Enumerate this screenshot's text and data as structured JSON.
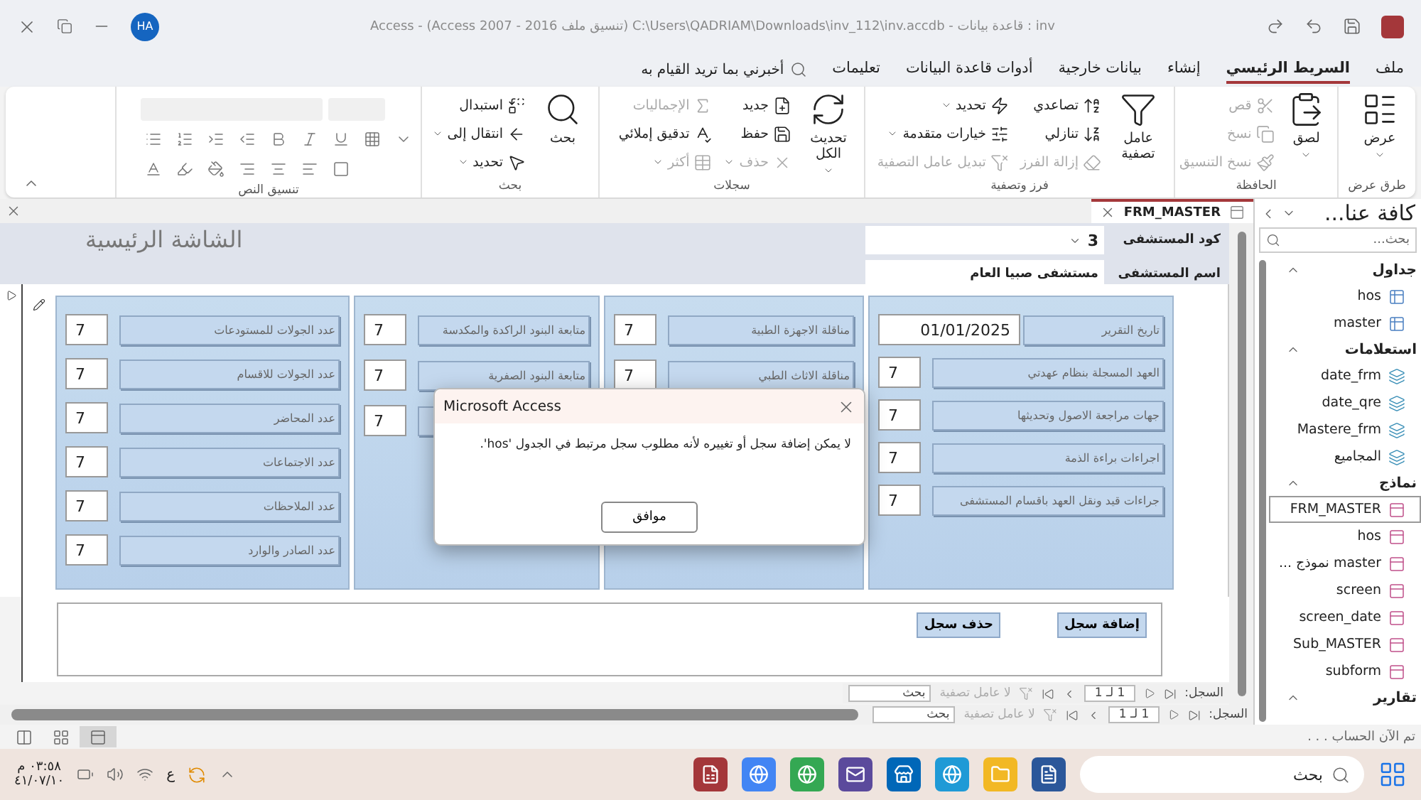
{
  "title_bar": {
    "title": "Access - (Access 2007 - 2016 تنسيق ملف) C:\\Users\\QADRIAM\\Downloads\\inv_112\\inv.accdb - قاعدة بيانات : inv",
    "avatar": "HA"
  },
  "menu": {
    "tabs": [
      {
        "label": "ملف",
        "selected": false
      },
      {
        "label": "السريط الرئيسي",
        "selected": true
      },
      {
        "label": "إنشاء",
        "selected": false
      },
      {
        "label": "بيانات خارجية",
        "selected": false
      },
      {
        "label": "أدوات قاعدة البيانات",
        "selected": false
      },
      {
        "label": "تعليمات",
        "selected": false
      }
    ],
    "tell_me": "أخبرني بما تريد القيام به"
  },
  "ribbon": {
    "groups": [
      {
        "label": "طرق عرض",
        "items": [
          {
            "label": "عرض",
            "kind": "large",
            "dropdown": true,
            "disabled": false
          }
        ]
      },
      {
        "label": "الحافظة",
        "items": [
          {
            "label": "لصق",
            "kind": "large",
            "dropdown": true,
            "disabled": false
          },
          {
            "label": "قص",
            "kind": "small",
            "disabled": true
          },
          {
            "label": "نسخ",
            "kind": "small",
            "disabled": true
          },
          {
            "label": "نسخ التنسيق",
            "kind": "small",
            "disabled": true
          }
        ]
      },
      {
        "label": "فرز وتصفية",
        "items": [
          {
            "label": "عامل تصفية",
            "kind": "large",
            "disabled": false
          },
          {
            "label": "تصاعدي",
            "kind": "small",
            "disabled": false
          },
          {
            "label": "تنازلي",
            "kind": "small",
            "disabled": false
          },
          {
            "label": "إزالة الفرز",
            "kind": "small",
            "disabled": true
          },
          {
            "label": "تحديد",
            "kind": "small",
            "dropdown": true,
            "disabled": false
          },
          {
            "label": "خيارات متقدمة",
            "kind": "small",
            "dropdown": true,
            "disabled": false
          },
          {
            "label": "تبديل عامل التصفية",
            "kind": "small",
            "disabled": true
          }
        ]
      },
      {
        "label": "سجلات",
        "items": [
          {
            "label": "تحديث الكل",
            "kind": "large",
            "dropdown": true,
            "disabled": false
          },
          {
            "label": "جديد",
            "kind": "small",
            "disabled": false
          },
          {
            "label": "حفظ",
            "kind": "small",
            "disabled": false
          },
          {
            "label": "حذف",
            "kind": "small",
            "dropdown": true,
            "disabled": true
          },
          {
            "label": "الإجماليات",
            "kind": "small",
            "disabled": true
          },
          {
            "label": "تدقيق إملائي",
            "kind": "small",
            "disabled": false
          },
          {
            "label": "أكثر",
            "kind": "small",
            "dropdown": true,
            "disabled": true
          }
        ]
      },
      {
        "label": "بحث",
        "items": [
          {
            "label": "بحث",
            "kind": "large",
            "disabled": false
          },
          {
            "label": "استبدال",
            "kind": "small",
            "disabled": false
          },
          {
            "label": "انتقال إلى",
            "kind": "small",
            "dropdown": true,
            "disabled": false
          },
          {
            "label": "تحديد",
            "kind": "small",
            "dropdown": true,
            "disabled": false
          }
        ]
      },
      {
        "label": "تنسيق النص"
      }
    ]
  },
  "doc_tabs": [
    {
      "label": "FRM_MASTER",
      "selected": true
    }
  ],
  "form": {
    "fields": [
      {
        "label": "كود المستشفى",
        "value": "3",
        "kind": "combo"
      },
      {
        "label": "اسم المستشفى",
        "value": "مستشفى صبيا العام",
        "kind": "text"
      }
    ],
    "title": "الشاشة الرئيسية",
    "panels": [
      {
        "rows": [
          {
            "label": "تاريخ التقرير",
            "value": "01/01/2025",
            "kind": "date"
          },
          {
            "label": "العهد المسجلة بنظام عهدتي",
            "value": "7",
            "kind": "number"
          },
          {
            "label": "جهات مراجعة الاصول وتحديثها",
            "value": "7",
            "kind": "number"
          },
          {
            "label": "اجراءات براءة الذمة",
            "value": "7",
            "kind": "number"
          },
          {
            "label": "جراءات قيد ونقل العهد باقسام  المستشفى",
            "value": "7",
            "kind": "number"
          }
        ]
      },
      {
        "rows": [
          {
            "label": "مناقلة الاجهزة الطبية",
            "value": "7",
            "kind": "number"
          },
          {
            "label": "مناقلة الاثاث الطبي",
            "value": "7",
            "kind": "number"
          }
        ]
      },
      {
        "rows": [
          {
            "label": "متابعة البنود الراكدة والمكدسة",
            "value": "7",
            "kind": "number"
          },
          {
            "label": "متابعة البنود الصفرية",
            "value": "7",
            "kind": "number"
          },
          {
            "value": "7",
            "kind": "number"
          }
        ]
      },
      {
        "rows": [
          {
            "label": "عدد الجولات للمستودعات",
            "value": "7",
            "kind": "number"
          },
          {
            "label": "عدد الجولات للاقسام",
            "value": "7",
            "kind": "number"
          },
          {
            "label": "عدد المحاضر",
            "value": "7",
            "kind": "number"
          },
          {
            "label": "عدد الاجتماعات",
            "value": "7",
            "kind": "number"
          },
          {
            "label": "عدد الملاحظات",
            "value": "7",
            "kind": "number"
          },
          {
            "label": "عدد الصادر والوارد",
            "value": "7",
            "kind": "number"
          }
        ]
      }
    ],
    "buttons": [
      "إضافة سجل",
      "حذف سجل"
    ]
  },
  "subform_nav": {
    "label": "السجل:",
    "position": "1 لـ 1",
    "filter": "لا عامل تصفية",
    "search": "بحث"
  },
  "form_nav": {
    "label": "السجل:",
    "position": "1 لـ 1",
    "filter": "لا عامل تصفية",
    "search": "بحث"
  },
  "dialog": {
    "title": "Microsoft Access",
    "message": "لا يمكن إضافة سجل أو تغييره لأنه مطلوب سجل مرتبط في الجدول 'hos'.",
    "button": "موافق"
  },
  "nav_pane": {
    "title": "كافة عنا...",
    "search_placeholder": "بحث...",
    "groups": [
      {
        "label": "جداول",
        "expanded": true,
        "items": [
          {
            "label": "hos",
            "selected": false
          },
          {
            "label": "master",
            "selected": false
          }
        ]
      },
      {
        "label": "استعلامات",
        "expanded": true,
        "items": [
          {
            "label": "date_frm",
            "selected": false
          },
          {
            "label": "date_qre",
            "selected": false
          },
          {
            "label": "Mastere_frm",
            "selected": false
          },
          {
            "label": "المجاميع",
            "selected": false
          }
        ]
      },
      {
        "label": "نماذج",
        "expanded": true,
        "items": [
          {
            "label": "FRM_MASTER",
            "selected": true
          },
          {
            "label": "hos",
            "selected": false
          },
          {
            "label": "master نموذج ...",
            "selected": false
          },
          {
            "label": "screen",
            "selected": false
          },
          {
            "label": "screen_date",
            "selected": false
          },
          {
            "label": "Sub_MASTER",
            "selected": false
          },
          {
            "label": "subform",
            "selected": false
          }
        ]
      },
      {
        "label": "تقارير",
        "expanded": true
      }
    ]
  },
  "status_bar": {
    "message": "تم الآن الحساب . . .",
    "views": [
      {
        "selected": false
      },
      {
        "selected": false
      },
      {
        "selected": true
      }
    ]
  },
  "taskbar": {
    "search_placeholder": "بحث",
    "language": "ع",
    "time": "٠٣:٥٨ م",
    "date": "٤١/٠٧/١٠"
  }
}
